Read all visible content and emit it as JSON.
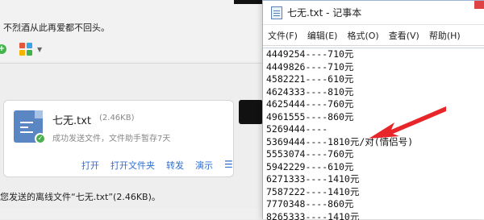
{
  "chat": {
    "recent_message": "不烈酒从此再爱都不回头。",
    "file_card": {
      "file_name": "七无.txt",
      "file_size": "(2.46KB)",
      "status": "成功发送文件，文件助手暂存7天",
      "actions": [
        "打开",
        "打开文件夹",
        "转发",
        "演示"
      ]
    },
    "bottom_note": "您发送的离线文件“七无.txt”(2.46KB)。"
  },
  "notepad": {
    "title": "七无.txt - 记事本",
    "menu": [
      "文件(F)",
      "编辑(E)",
      "格式(O)",
      "查看(V)",
      "帮助(H)"
    ],
    "lines": [
      "4449254----710元",
      "4449826----710元",
      "4582221----610元",
      "4624333----810元",
      "4625444----760元",
      "4961555----860元",
      "5269444----",
      "5369444----1810元/对(情侣号)",
      "5553074----760元",
      "5942229----610元",
      "6271333----1410元",
      "7587222----1410元",
      "7770348----860元",
      "8265333----1410元"
    ]
  },
  "colors": {
    "accent_link": "#2f6fd1",
    "arrow": "#e8262a",
    "doc_icon": "#5b86c4"
  }
}
